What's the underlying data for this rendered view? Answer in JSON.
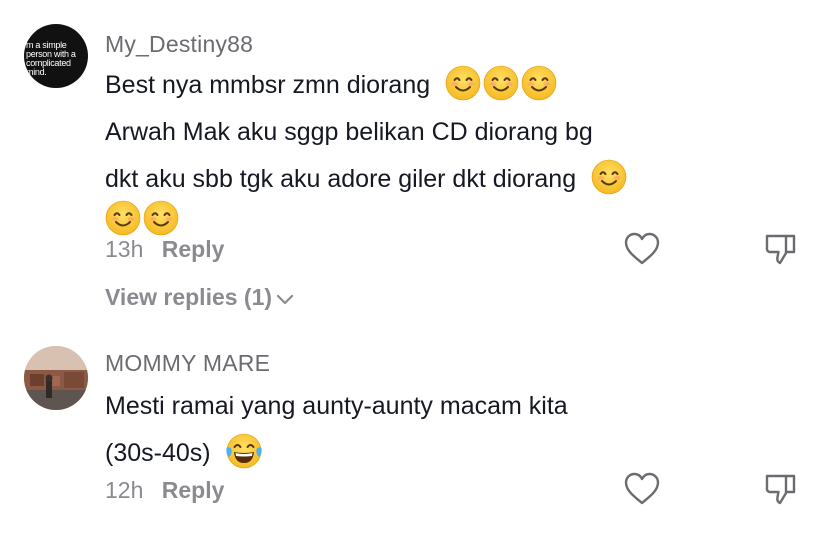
{
  "comments": [
    {
      "username": "My_Destiny88",
      "avatar_text": "m a simple\nperson with a\ncomplicated\nmind.",
      "lines": [
        "Best nya mmbsr zmn diorang",
        "Arwah Mak aku sggp belikan CD diorang bg",
        "dkt aku sbb tgk aku adore giler dkt diorang"
      ],
      "time": "13h",
      "reply_label": "Reply",
      "view_replies_label": "View replies (1)"
    },
    {
      "username": "MOMMY MARE",
      "lines": [
        "Mesti ramai yang aunty-aunty macam kita",
        "(30s-40s)"
      ],
      "time": "12h",
      "reply_label": "Reply"
    }
  ],
  "icons": {
    "smile": "smiling-face-emoji",
    "laugh": "tears-of-joy-emoji",
    "like": "heart-outline-icon",
    "dislike": "thumbs-down-icon",
    "expand": "chevron-down-icon"
  },
  "colors": {
    "username": "#6b6b72",
    "meta": "#8a8b91",
    "text": "#161823"
  }
}
